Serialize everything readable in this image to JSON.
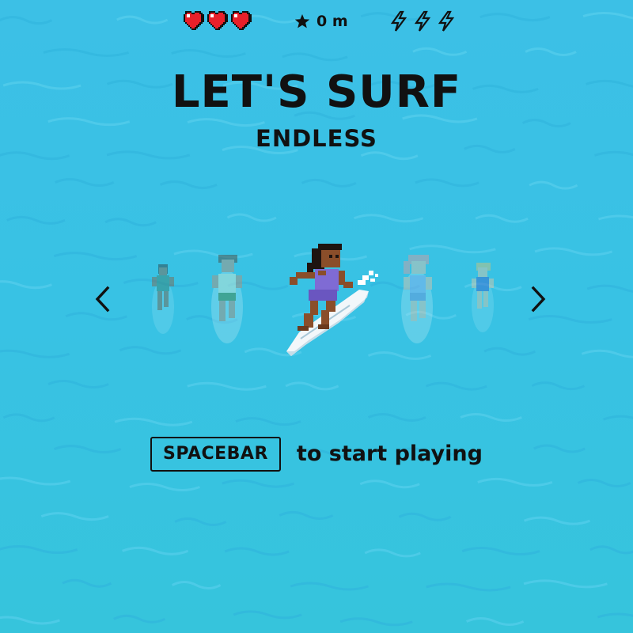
{
  "game": {
    "title": "LET'S SURF",
    "mode": "ENDLESS"
  },
  "hud": {
    "lives": 3,
    "distance": "0 m",
    "boosts": 3,
    "icons": {
      "lives": "heart-icon",
      "distance": "star-icon",
      "boosts": "lightning-icon"
    }
  },
  "character_select": {
    "selected_index": 2,
    "characters": [
      "surfer-1",
      "surfer-2",
      "surfer-3",
      "surfer-4",
      "surfer-5"
    ],
    "prev_icon": "chevron-left-icon",
    "next_icon": "chevron-right-icon"
  },
  "start_prompt": {
    "key": "SPACEBAR",
    "text": "to start playing"
  },
  "colors": {
    "ocean": "#38c2e4",
    "heart": "#e8202a",
    "text": "#111111"
  }
}
